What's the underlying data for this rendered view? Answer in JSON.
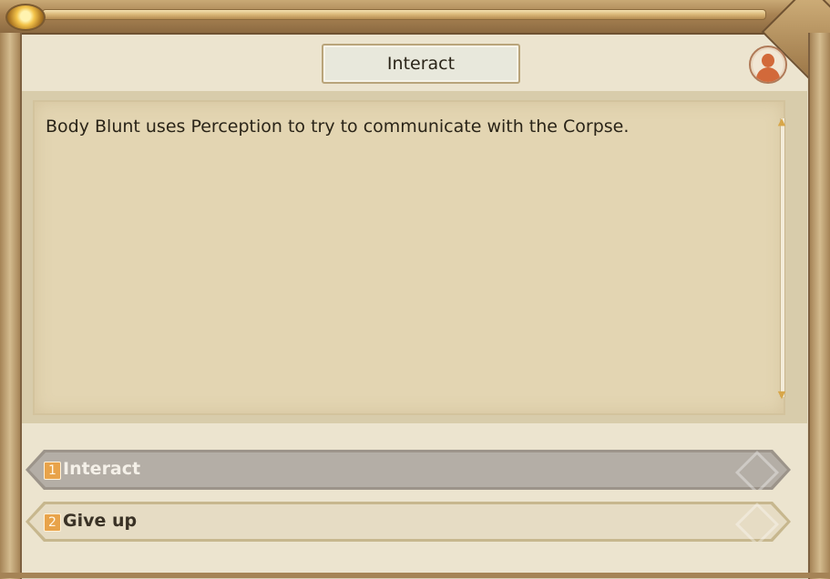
{
  "dialog": {
    "title": "Interact",
    "message": "Body Blunt uses Perception to try to communicate with the Corpse."
  },
  "options": [
    {
      "number": "1",
      "label": "Interact",
      "state": "highlighted"
    },
    {
      "number": "2",
      "label": "Give up",
      "state": "normal"
    }
  ],
  "icons": {
    "portrait": "character-portrait-icon",
    "gem": "gem-icon"
  },
  "colors": {
    "frame_gold": "#a98353",
    "panel_bg": "#ece4cf",
    "text_area": "#e3d5b2",
    "number_badge": "#e8a34a",
    "option_highlight": "#b4aea6"
  }
}
